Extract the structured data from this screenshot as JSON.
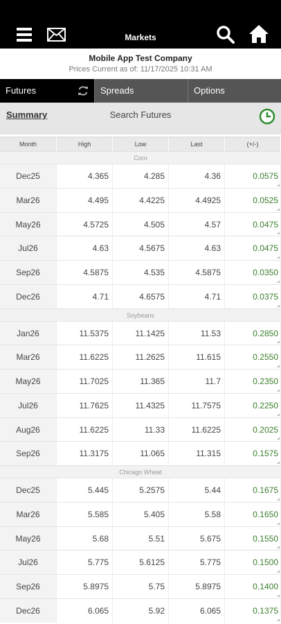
{
  "header": {
    "title": "Markets"
  },
  "company": "Mobile App Test Company",
  "as_of": "Prices Current as of: 11/17/2025 10:31 AM",
  "tabs": [
    {
      "label": "Futures"
    },
    {
      "label": "Spreads"
    },
    {
      "label": "Options"
    }
  ],
  "subbar": {
    "summary": "Summary",
    "search": "Search Futures"
  },
  "columns": [
    "Month",
    "High",
    "Low",
    "Last",
    "(+/-)"
  ],
  "groups": [
    {
      "name": "Corn",
      "rows": [
        [
          "Dec25",
          "4.365",
          "4.285",
          "4.36",
          "0.0575"
        ],
        [
          "Mar26",
          "4.495",
          "4.4225",
          "4.4925",
          "0.0525"
        ],
        [
          "May26",
          "4.5725",
          "4.505",
          "4.57",
          "0.0475"
        ],
        [
          "Jul26",
          "4.63",
          "4.5675",
          "4.63",
          "0.0475"
        ],
        [
          "Sep26",
          "4.5875",
          "4.535",
          "4.5875",
          "0.0350"
        ],
        [
          "Dec26",
          "4.71",
          "4.6575",
          "4.71",
          "0.0375"
        ]
      ]
    },
    {
      "name": "Soybeans",
      "rows": [
        [
          "Jan26",
          "11.5375",
          "11.1425",
          "11.53",
          "0.2850"
        ],
        [
          "Mar26",
          "11.6225",
          "11.2625",
          "11.615",
          "0.2550"
        ],
        [
          "May26",
          "11.7025",
          "11.365",
          "11.7",
          "0.2350"
        ],
        [
          "Jul26",
          "11.7625",
          "11.4325",
          "11.7575",
          "0.2250"
        ],
        [
          "Aug26",
          "11.6225",
          "11.33",
          "11.6225",
          "0.2025"
        ],
        [
          "Sep26",
          "11.3175",
          "11.065",
          "11.315",
          "0.1575"
        ]
      ]
    },
    {
      "name": "Chicago Wheat",
      "rows": [
        [
          "Dec25",
          "5.445",
          "5.2575",
          "5.44",
          "0.1675"
        ],
        [
          "Mar26",
          "5.585",
          "5.405",
          "5.58",
          "0.1650"
        ],
        [
          "May26",
          "5.68",
          "5.51",
          "5.675",
          "0.1550"
        ],
        [
          "Jul26",
          "5.775",
          "5.6125",
          "5.775",
          "0.1500"
        ],
        [
          "Sep26",
          "5.8975",
          "5.75",
          "5.8975",
          "0.1400"
        ],
        [
          "Dec26",
          "6.065",
          "5.92",
          "6.065",
          "0.1375"
        ]
      ]
    }
  ],
  "colors": {
    "topbar": "#000000",
    "active_tab": "#000000",
    "inactive_tab": "#555555",
    "positive_change": "#3a7d2c",
    "clock_green": "#2e8b2e"
  },
  "icons": [
    "menu-icon",
    "mail-icon",
    "search-icon",
    "home-icon",
    "refresh-icon",
    "clock-icon"
  ]
}
